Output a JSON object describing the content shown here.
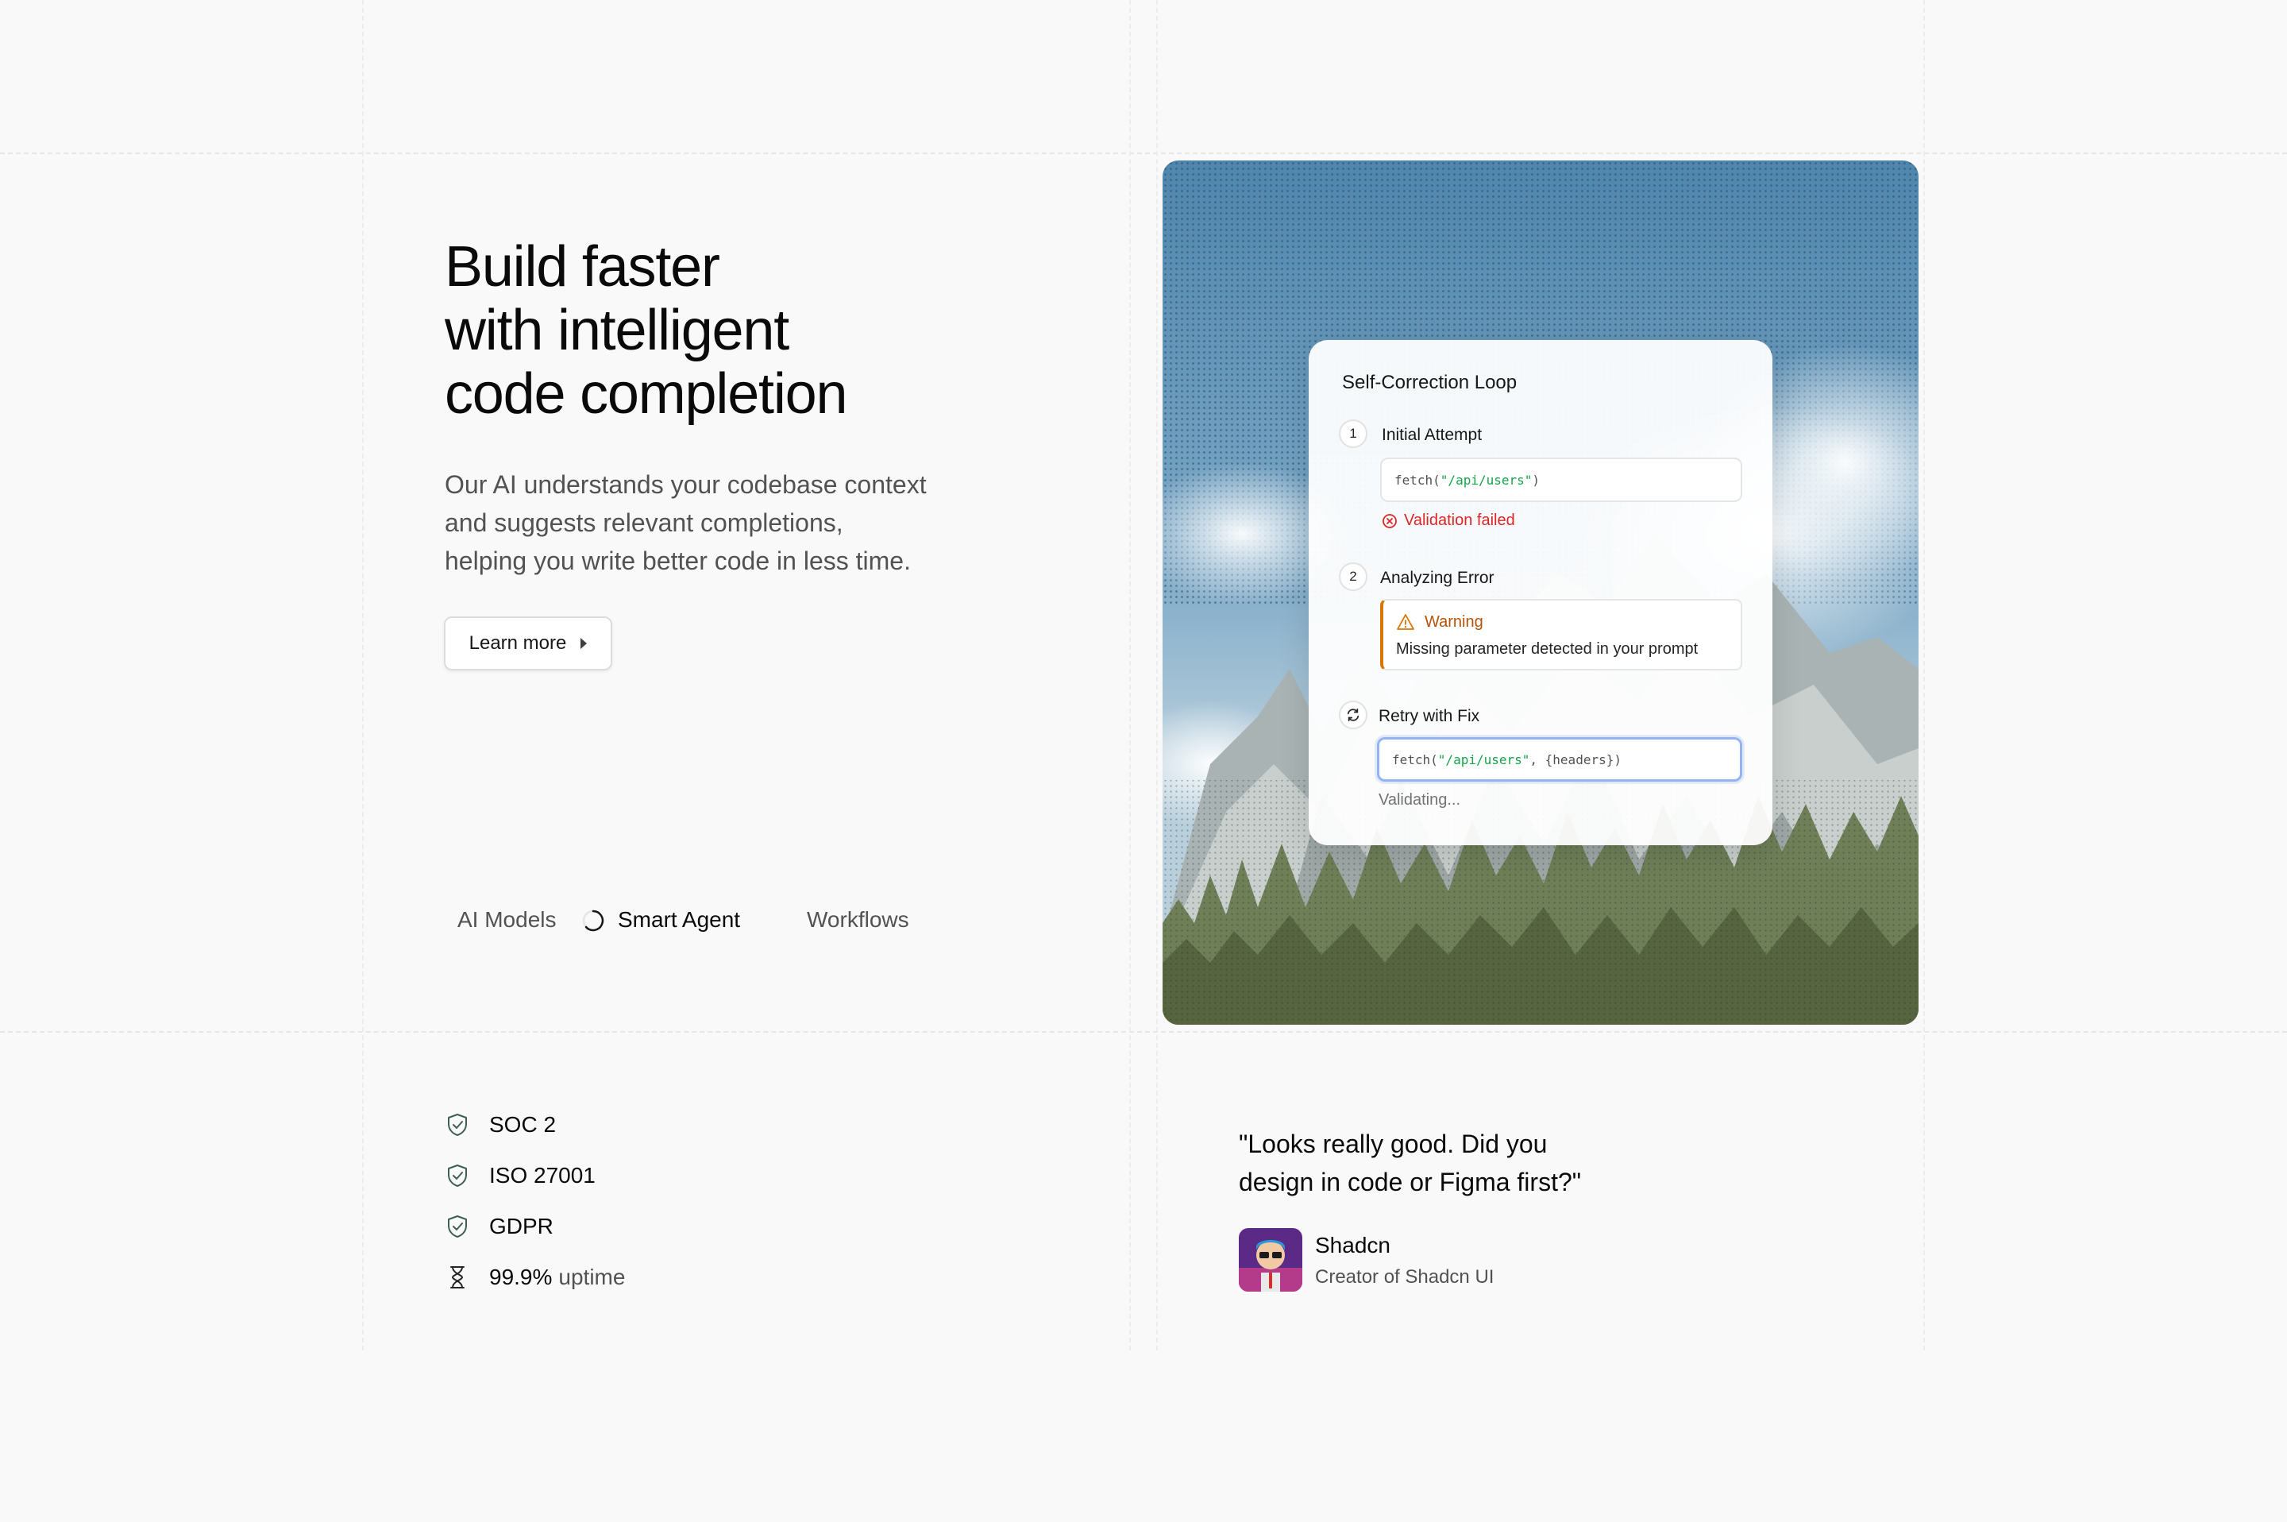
{
  "hero": {
    "title_lines": [
      "Build faster",
      "with intelligent",
      "code completion"
    ],
    "description_lines": [
      "Our AI understands your codebase context",
      "and suggests relevant completions,",
      "helping you write better code in less time."
    ],
    "cta_label": "Learn more"
  },
  "tabs": [
    {
      "label": "AI Models",
      "active": false
    },
    {
      "label": "Smart Agent",
      "active": true
    },
    {
      "label": "Workflows",
      "active": false
    }
  ],
  "card": {
    "title": "Self-Correction Loop",
    "step1": {
      "number": "1",
      "label": "Initial Attempt",
      "code_prefix": "fetch(",
      "code_string": "\"/api/users\"",
      "code_suffix": ")",
      "status": "Validation failed"
    },
    "step2": {
      "number": "2",
      "label": "Analyzing Error",
      "warning_title": "Warning",
      "warning_text": "Missing parameter detected in your prompt"
    },
    "step3": {
      "label": "Retry with Fix",
      "code_prefix": "fetch(",
      "code_string": "\"/api/users\"",
      "code_suffix": ", {headers})",
      "status": "Validating..."
    }
  },
  "compliance": [
    {
      "icon": "shield-check-icon",
      "label": "SOC 2",
      "suffix": ""
    },
    {
      "icon": "shield-check-icon",
      "label": "ISO 27001",
      "suffix": ""
    },
    {
      "icon": "shield-check-icon",
      "label": "GDPR",
      "suffix": ""
    },
    {
      "icon": "hourglass-icon",
      "label": "99.9%",
      "suffix": "uptime"
    }
  ],
  "testimonial": {
    "quote_lines": [
      "\"Looks really good. Did you",
      "design in code or Figma first?\""
    ],
    "author": "Shadcn",
    "role": "Creator of Shadcn UI"
  },
  "colors": {
    "error": "#dc2626",
    "warning": "#d97706",
    "code_string": "#16a34a",
    "focus_ring": "#93b4f0"
  }
}
